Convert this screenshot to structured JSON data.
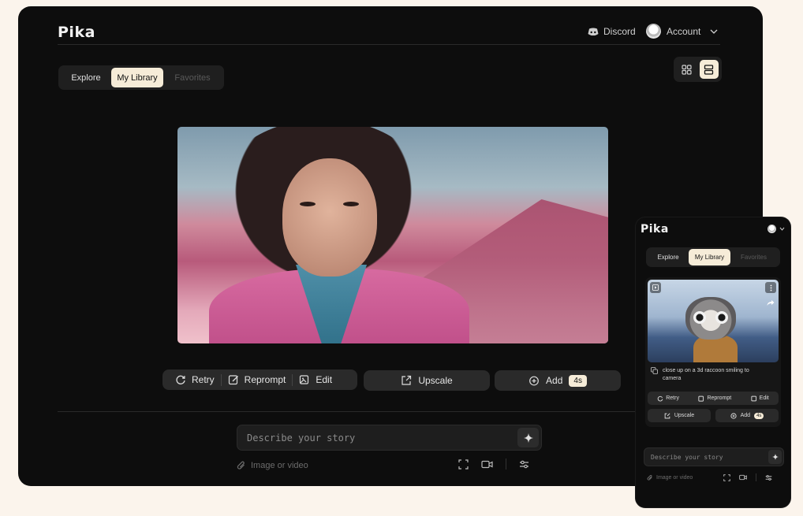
{
  "desktop": {
    "logo": "Pika",
    "header": {
      "discord_label": "Discord",
      "account_label": "Account"
    },
    "tabs": [
      "Explore",
      "My Library",
      "Favorites"
    ],
    "active_tab": "My Library",
    "actions": {
      "retry": "Retry",
      "reprompt": "Reprompt",
      "edit": "Edit",
      "upscale": "Upscale",
      "add": "Add",
      "add_badge": "4s"
    },
    "prompt": {
      "placeholder": "Describe your story",
      "attach_label": "Image or video"
    }
  },
  "mobile": {
    "logo": "Pika",
    "tabs": [
      "Explore",
      "My Library",
      "Favorites"
    ],
    "active_tab": "My Library",
    "card": {
      "caption": "close up on a 3d raccoon smiling to camera",
      "actions": {
        "retry": "Retry",
        "reprompt": "Reprompt",
        "edit": "Edit",
        "upscale": "Upscale",
        "add": "Add",
        "add_badge": "4s"
      }
    },
    "prompt": {
      "placeholder": "Describe your story",
      "attach_label": "Image or video"
    }
  },
  "colors": {
    "background": "#fbf4ec",
    "panel": "#0d0d0d",
    "accent": "#f6ecd8"
  },
  "icons": [
    "discord-icon",
    "chevron-down-icon",
    "grid-view-icon",
    "list-view-icon",
    "retry-icon",
    "reprompt-icon",
    "edit-icon",
    "upscale-icon",
    "add-icon",
    "sparkle-icon",
    "paperclip-icon",
    "expand-icon",
    "camera-icon",
    "sliders-icon",
    "copy-icon",
    "video-icon",
    "more-icon",
    "share-icon"
  ]
}
